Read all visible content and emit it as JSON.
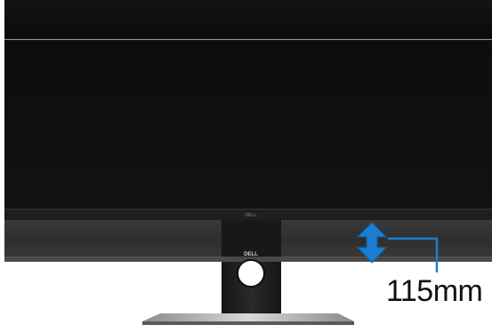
{
  "image": {
    "subject": "monitor",
    "brand_logos": [
      "DELL",
      "DELL"
    ],
    "colors": {
      "screen": "#0b0b0b",
      "bezel": "#2a2a2a",
      "stand": "#1c1c1c",
      "arrow": "#1a7fd0",
      "indicator_line": "#1a7fd0"
    }
  },
  "height_adjustment": {
    "label": "115mm",
    "icon": "double-arrow-vertical-icon"
  }
}
